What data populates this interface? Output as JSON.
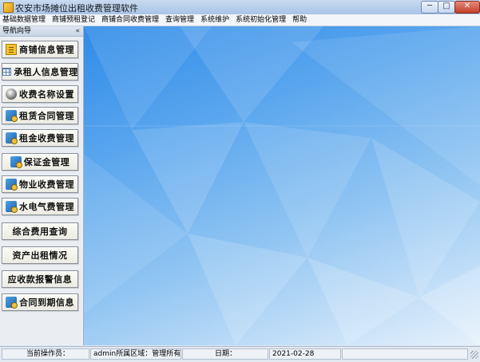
{
  "window": {
    "title": "农安市场摊位出租收费管理软件",
    "controls": {
      "minimize": "─",
      "maximize": "□",
      "close": "✕"
    },
    "icon": "app-icon"
  },
  "menu": {
    "items": [
      "基础数据管理",
      "商铺预租登记",
      "商铺合同收费管理",
      "查询管理",
      "系统维护",
      "系统初始化管理",
      "帮助"
    ]
  },
  "nav": {
    "title": "导航向导",
    "collapse": "«",
    "items": [
      {
        "label": "商铺信息管理",
        "icon": "document-icon"
      },
      {
        "label": "承租人信息管理",
        "icon": "table-icon"
      },
      {
        "label": "收费名称设置",
        "icon": "money-bag-icon"
      },
      {
        "label": "租赁合同管理",
        "icon": "search-icon"
      },
      {
        "label": "租金收费管理",
        "icon": "search-icon"
      },
      {
        "label": "保证金管理",
        "icon": "search-icon"
      },
      {
        "label": "物业收费管理",
        "icon": "search-icon"
      },
      {
        "label": "水电气费管理",
        "icon": "search-icon"
      },
      {
        "label": "综合费用查询",
        "icon": ""
      },
      {
        "label": "资产出租情况",
        "icon": ""
      },
      {
        "label": "应收款报警信息",
        "icon": ""
      },
      {
        "label": "合同到期信息",
        "icon": "search-icon"
      }
    ]
  },
  "status": {
    "operator_label": "当前操作员：",
    "user": "admin所属区域：管理所有区",
    "date_label": "日期：",
    "date": "2021-02-28"
  },
  "colors": {
    "background_top": "#2f8be8",
    "background_bottom": "#e6f1fb",
    "nav_bg": "#eaeef3"
  }
}
